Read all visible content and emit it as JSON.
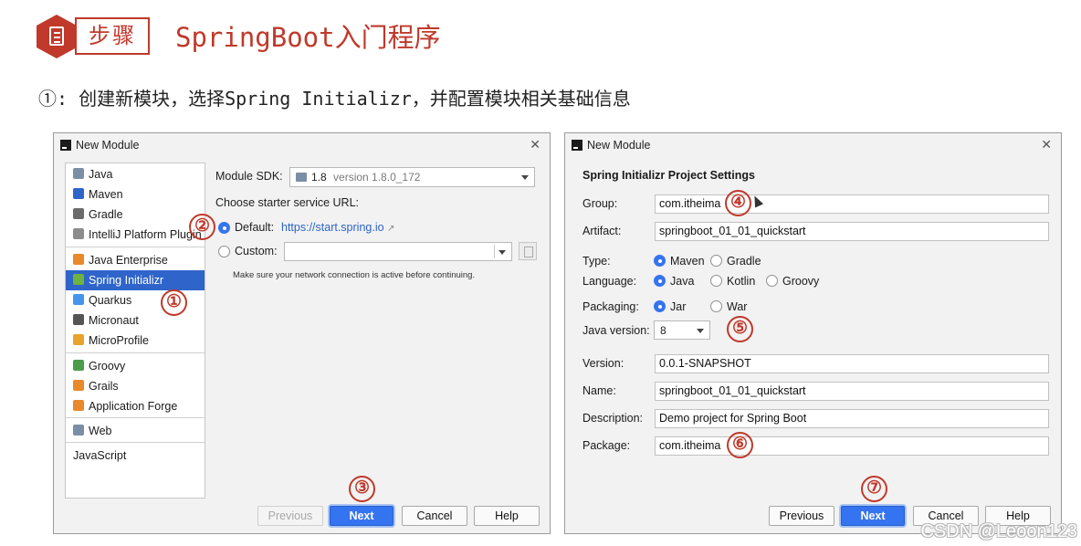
{
  "slide": {
    "step_label": "步骤",
    "title": "SpringBoot入门程序",
    "subtitle": "①: 创建新模块，选择Spring Initializr，并配置模块相关基础信息"
  },
  "dialog1": {
    "title": "New Module",
    "sidebar": [
      {
        "label": "Java",
        "icon": "java-folder-icon",
        "color": "#7a8fa6"
      },
      {
        "label": "Maven",
        "icon": "maven-icon",
        "color": "#2f65ca"
      },
      {
        "label": "Gradle",
        "icon": "gradle-icon",
        "color": "#6b6b6b"
      },
      {
        "label": "IntelliJ Platform Plugin",
        "icon": "plugin-icon",
        "color": "#8c8c8c"
      },
      {
        "label": "Java Enterprise",
        "icon": "java-enterprise-icon",
        "color": "#e8892a"
      },
      {
        "label": "Spring Initializr",
        "icon": "spring-icon",
        "color": "#6db33f"
      },
      {
        "label": "Quarkus",
        "icon": "quarkus-icon",
        "color": "#4695eb"
      },
      {
        "label": "Micronaut",
        "icon": "micronaut-icon",
        "color": "#555555"
      },
      {
        "label": "MicroProfile",
        "icon": "microprofile-icon",
        "color": "#e8a32a"
      },
      {
        "label": "Groovy",
        "icon": "groovy-icon",
        "color": "#4a9b4a"
      },
      {
        "label": "Grails",
        "icon": "grails-icon",
        "color": "#e8892a"
      },
      {
        "label": "Application Forge",
        "icon": "forge-icon",
        "color": "#e8892a"
      },
      {
        "label": "Web",
        "icon": "globe-icon",
        "color": "#7a8fa6"
      },
      {
        "label": "JavaScript",
        "icon": "",
        "color": ""
      }
    ],
    "selected": "Spring Initializr",
    "sdk_label": "Module SDK:",
    "sdk_value": "1.8",
    "sdk_version": "version 1.8.0_172",
    "choose_url_label": "Choose starter service URL:",
    "default_label": "Default:",
    "default_url": "https://start.spring.io",
    "custom_label": "Custom:",
    "custom_value": "",
    "network_note": "Make sure your network connection is active before continuing.",
    "buttons": {
      "previous": "Previous",
      "next": "Next",
      "cancel": "Cancel",
      "help": "Help"
    }
  },
  "dialog2": {
    "title": "New Module",
    "section": "Spring Initializr Project Settings",
    "group_label": "Group:",
    "group_value": "com.itheima",
    "artifact_label": "Artifact:",
    "artifact_value": "springboot_01_01_quickstart",
    "type_label": "Type:",
    "type_options": [
      "Maven",
      "Gradle"
    ],
    "type_selected": "Maven",
    "language_label": "Language:",
    "language_options": [
      "Java",
      "Kotlin",
      "Groovy"
    ],
    "language_selected": "Java",
    "packaging_label": "Packaging:",
    "packaging_options": [
      "Jar",
      "War"
    ],
    "packaging_selected": "Jar",
    "java_version_label": "Java version:",
    "java_version_value": "8",
    "version_label": "Version:",
    "version_value": "0.0.1-SNAPSHOT",
    "name_label": "Name:",
    "name_value": "springboot_01_01_quickstart",
    "description_label": "Description:",
    "description_value": "Demo project for Spring Boot",
    "package_label": "Package:",
    "package_value": "com.itheima",
    "buttons": {
      "previous": "Previous",
      "next": "Next",
      "cancel": "Cancel",
      "help": "Help"
    }
  },
  "annotations": [
    "①",
    "②",
    "③",
    "④",
    "⑤",
    "⑥",
    "⑦"
  ],
  "watermark": "CSDN @Leoon123",
  "colors": {
    "accent_red": "#c0392b",
    "selection_blue": "#2f65ca",
    "button_blue": "#3574f0",
    "link_blue": "#2c64c7"
  }
}
